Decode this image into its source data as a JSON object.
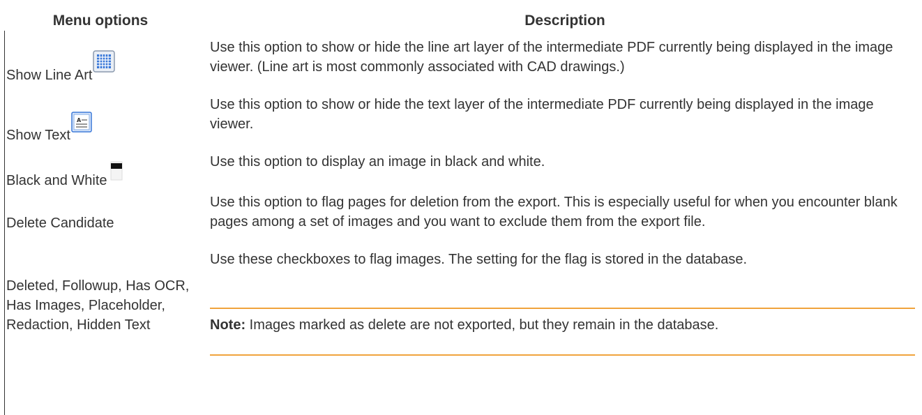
{
  "header": {
    "menu_options": "Menu options",
    "description": "Description"
  },
  "rows": [
    {
      "option": "Show Line Art",
      "icon": "line-art-grid-icon",
      "description": "Use this option to show or hide the line art layer of the intermediate PDF currently being displayed in the image viewer. (Line art is most commonly associated with CAD drawings.)"
    },
    {
      "option": "Show Text",
      "icon": "text-layer-icon",
      "description": "Use this option to show or hide the text layer of the intermediate PDF currently being displayed in the image viewer."
    },
    {
      "option": "Black and White",
      "icon": "black-white-icon",
      "description": "Use this option to display an image in black and white."
    },
    {
      "option": "Delete Candidate",
      "description": "Use this option to flag pages for deletion from the export. This is especially useful for when you encounter blank pages among a set of images and you want to exclude them from the export file."
    },
    {
      "option": "Deleted, Followup, Has OCR, Has Images, Placeholder, Redaction, Hidden Text",
      "description": "Use these checkboxes to flag images. The setting for the flag is stored in the database.",
      "note_label": "Note:",
      "note_text": " Images marked as delete are not exported, but they remain in the database."
    }
  ],
  "colors": {
    "text": "#333333",
    "note_rule": "#f0a33c",
    "icon_blue": "#3a78d8"
  }
}
